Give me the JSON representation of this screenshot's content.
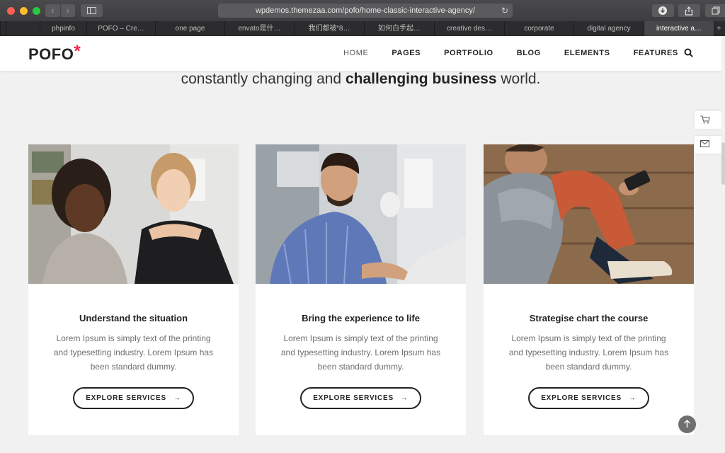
{
  "browser": {
    "url": "wpdemos.themezaa.com/pofo/home-classic-interactive-agency/",
    "tabs": [
      {
        "label": ""
      },
      {
        "label": ""
      },
      {
        "label": "phpinfo"
      },
      {
        "label": "POFO – Cre…"
      },
      {
        "label": "one page"
      },
      {
        "label": "envato是什…"
      },
      {
        "label": "我们都被“8…"
      },
      {
        "label": "如何白手起…"
      },
      {
        "label": "creative des…"
      },
      {
        "label": "corporate"
      },
      {
        "label": "digital agency"
      },
      {
        "label": "interactive a…",
        "active": true
      }
    ]
  },
  "site": {
    "logo_text": "POFO",
    "logo_mark": "*",
    "accent_color": "#ff214f",
    "menu": [
      "HOME",
      "PAGES",
      "PORTFOLIO",
      "BLOG",
      "ELEMENTS",
      "FEATURES"
    ]
  },
  "tagline": {
    "prefix": "constantly changing and ",
    "bold": "challenging business",
    "suffix": " world."
  },
  "cards": [
    {
      "title": "Understand the situation",
      "text": "Lorem Ipsum is simply text of the printing and typesetting industry. Lorem Ipsum has been standard dummy.",
      "button": "EXPLORE SERVICES"
    },
    {
      "title": "Bring the experience to life",
      "text": "Lorem Ipsum is simply text of the printing and typesetting industry. Lorem Ipsum has been standard dummy.",
      "button": "EXPLORE SERVICES"
    },
    {
      "title": "Strategise chart the course",
      "text": "Lorem Ipsum is simply text of the printing and typesetting industry. Lorem Ipsum has been standard dummy.",
      "button": "EXPLORE SERVICES"
    }
  ],
  "side_icons": [
    "cart-icon",
    "mail-icon"
  ],
  "scroll_top_icon": "arrow-up-icon"
}
